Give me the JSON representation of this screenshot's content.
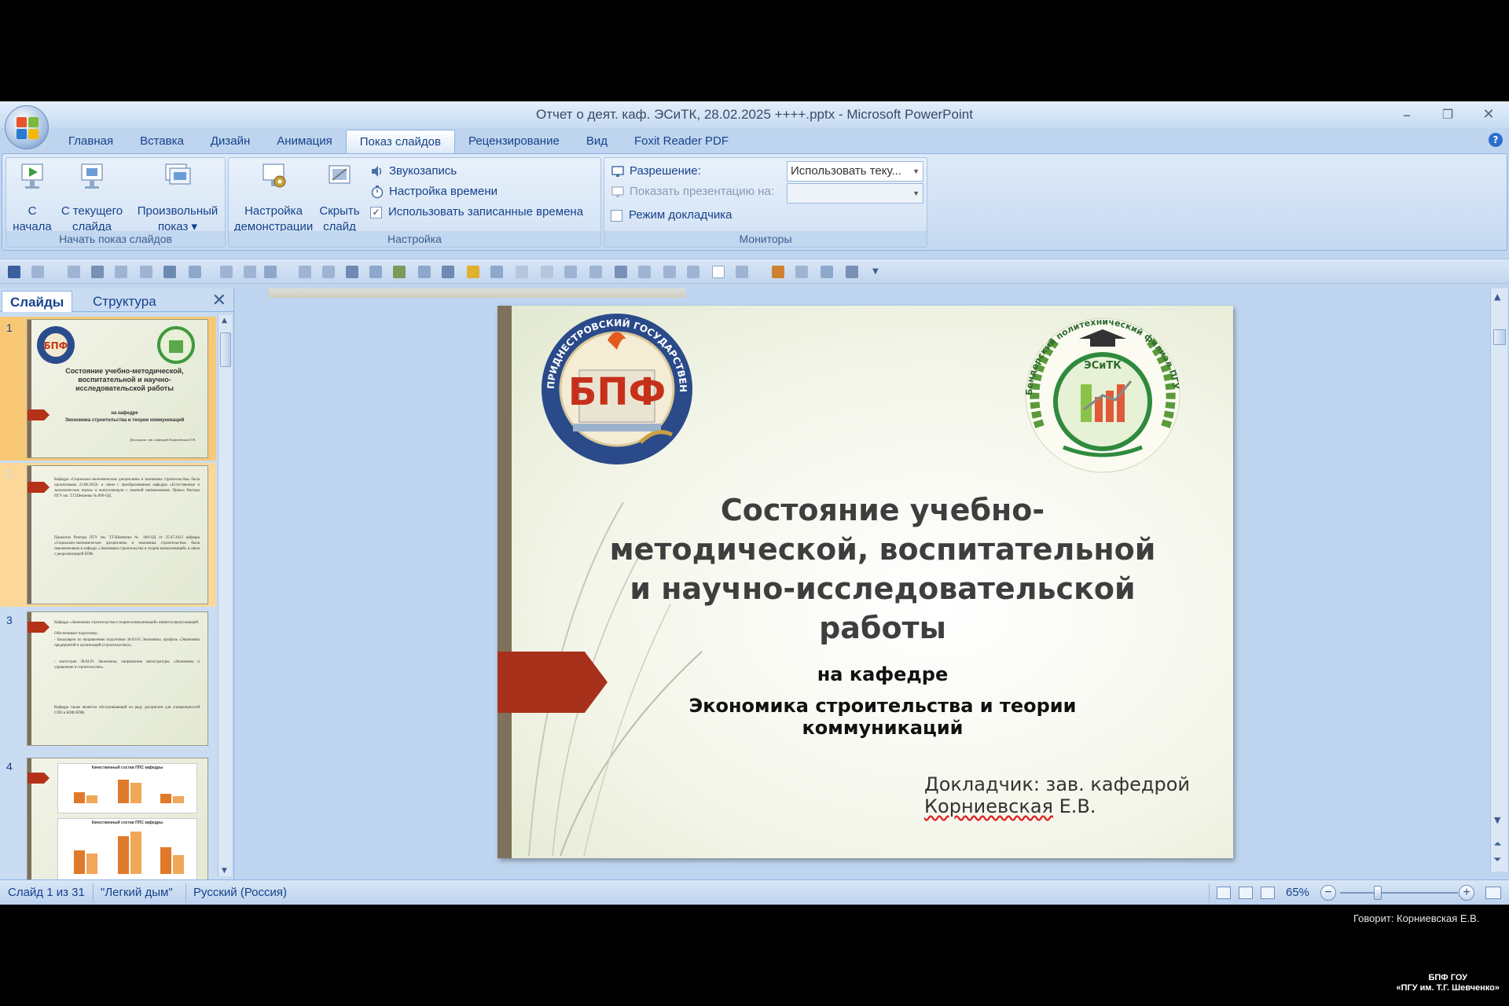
{
  "window": {
    "title": "Отчет о деят. каф. ЭСиТК, 28.02.2025 ++++.pptx - Microsoft PowerPoint",
    "minimize": "–",
    "restore": "❐",
    "close": "✕"
  },
  "tabs": [
    "Главная",
    "Вставка",
    "Дизайн",
    "Анимация",
    "Показ слайдов",
    "Рецензирование",
    "Вид",
    "Foxit Reader PDF"
  ],
  "active_tab": "Показ слайдов",
  "help": "?",
  "ribbon": {
    "group_start": {
      "label": "Начать показ слайдов",
      "from_start": [
        "С",
        "начала"
      ],
      "from_current": [
        "С текущего",
        "слайда"
      ],
      "custom": [
        "Произвольный",
        "показ ▾"
      ]
    },
    "group_setup": {
      "label": "Настройка",
      "setup_show": [
        "Настройка",
        "демонстрации"
      ],
      "hide_slide": [
        "Скрыть",
        "слайд"
      ],
      "record_sound": "Звукозапись",
      "rehearse": "Настройка времени",
      "use_timings": "Использовать записанные времена",
      "use_timings_checked": "✓"
    },
    "group_monitors": {
      "label": "Мониторы",
      "resolution_label": "Разрешение:",
      "resolution_value": "Использовать теку...",
      "show_on_label": "Показать презентацию на:",
      "presenter_view": "Режим докладчика"
    }
  },
  "pane": {
    "tab_slides": "Слайды",
    "tab_outline": "Структура",
    "close": "✕",
    "thumbs": [
      {
        "num": "1",
        "title": "Состояние учебно-методической, воспитательной и научно-исследовательской работы",
        "sub": "на кафедре",
        "sub2": "Экономика строительства и теории коммуникаций",
        "author": "Докладчик: зав. кафедрой Корниевская Е.В."
      },
      {
        "num": "2",
        "p1": "Кафедра «Социально-экономические дисциплины и экономика строительства» была организована 23.08.2022г. в связи с преобразованием кафедры «Естественные и экономические науки» в выпускающую с заменой наименования. Приказ Ректора ПГУ им. Т.Г.Шевченко № 890-ОД.",
        "p2": "Приказом Ректора ПГУ им. Т.Г.Шевченко № 860-ОД от 25.07.2023 кафедра «Социально-экономические дисциплины и экономика строительства» была переименована в кафедру «Экономика строительства и теории коммуникаций» в связи с реорганизацией БПФ."
      },
      {
        "num": "3",
        "p1": "Кафедра «Экономика строительства и теории коммуникаций» является выпускающей.",
        "p2": "Обеспечивает подготовку:",
        "p3": "- бакалавров по направлению подготовки 38.03.01 Экономика, профиль «Экономика предприятий и организаций (строительство)»;",
        "p4": "- магистров 38.04.01 Экономика, направление магистратуры «Экономика и управление в строительстве».",
        "p5": "Кафедра также является обслуживающей по ряду дисциплин для специальностей СПО в БПФ ВПФ."
      },
      {
        "num": "4",
        "chart_title_1": "Качественный состав ППС кафедры",
        "chart_title_2": "Качественный состав ППС кафедры"
      }
    ]
  },
  "slide": {
    "logo_left_text": "ПРИДНЕСТРОВСКИЙ ГОСУДАРСТВЕННЫЙ УНИВЕРСИТЕТ им. Т.Г. ШЕВЧЕНКО",
    "logo_left_mark": "БПФ",
    "logo_right_text": "Бендерский политехнический филиал ПГУ им. Т.Г. Шевченко",
    "logo_right_mark": "ЭСиТК",
    "title_lines": [
      "Состояние учебно-",
      "методической, воспитательной",
      "и научно-исследовательской",
      "работы"
    ],
    "sub1": "на кафедре",
    "sub2_lines": [
      "Экономика строительства и теории",
      "коммуникаций"
    ],
    "author_line1": "Докладчик: зав. кафедрой",
    "author_name": "Корниевская",
    "author_initials": " Е.В."
  },
  "status": {
    "slide_of": "Слайд 1 из 31",
    "theme": "\"Легкий дым\"",
    "language": "Русский (Россия)",
    "zoom": "65%",
    "zoom_minus": "−",
    "zoom_plus": "+"
  },
  "overlay": {
    "speaker": "Говорит: Корниевская Е.В.",
    "org_line1": "БПФ ГОУ",
    "org_line2": "«ПГУ им. Т.Г. Шевченко»"
  },
  "colors": {
    "ribbon_bg": "#c5d9f1",
    "accent_flag": "#a7311b",
    "slide_bar": "#7f715b",
    "selection": "#f8c876"
  }
}
